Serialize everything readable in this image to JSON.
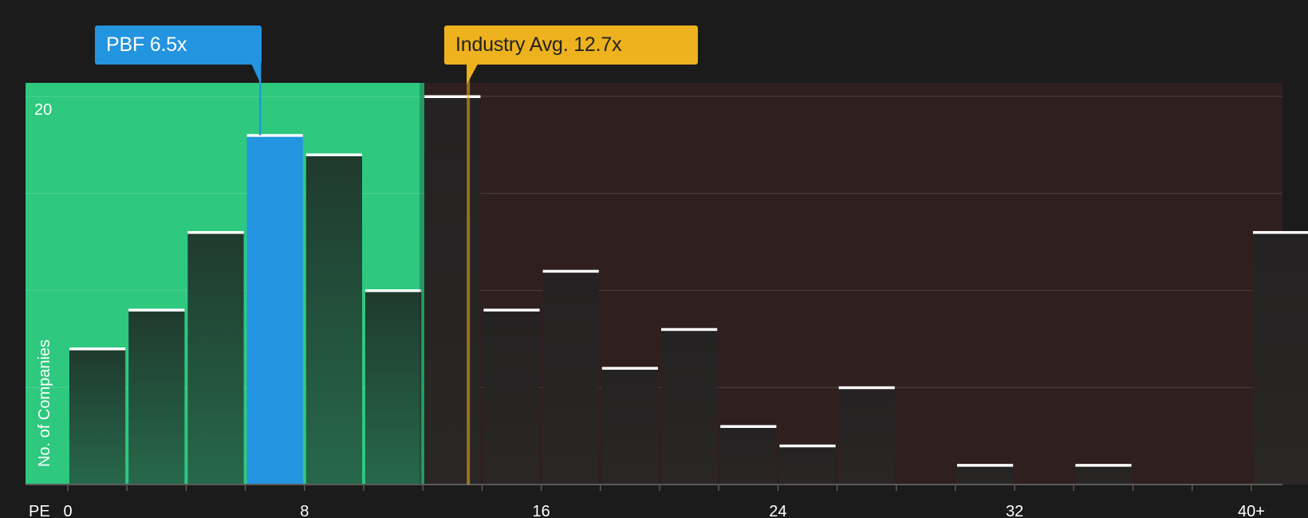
{
  "company_label": "PBF 6.5x",
  "industry_label": "Industry Avg. 12.7x",
  "colors": {
    "background": "#1b1b1b",
    "undervalued_zone": "#2ec87f",
    "overvalued_zone": "#2f1f1f",
    "company_accent": "#2394e0",
    "industry_accent": "#edb21d",
    "bar_cap": "#ffffff"
  },
  "chart_data": {
    "type": "bar",
    "title": "",
    "xlabel": "PE",
    "ylabel": "No. of Companies",
    "x_ticks": [
      "0",
      "8",
      "16",
      "24",
      "32",
      "40+"
    ],
    "y_ticks": [
      "20"
    ],
    "ylim": [
      0,
      20
    ],
    "bin_width": 2,
    "bins": [
      {
        "x_start": 0,
        "count": 7
      },
      {
        "x_start": 2,
        "count": 9
      },
      {
        "x_start": 4,
        "count": 13
      },
      {
        "x_start": 6,
        "count": 18,
        "highlight": true
      },
      {
        "x_start": 8,
        "count": 17
      },
      {
        "x_start": 10,
        "count": 10
      },
      {
        "x_start": 12,
        "count": 20
      },
      {
        "x_start": 14,
        "count": 9
      },
      {
        "x_start": 16,
        "count": 11
      },
      {
        "x_start": 18,
        "count": 6
      },
      {
        "x_start": 20,
        "count": 8
      },
      {
        "x_start": 22,
        "count": 3
      },
      {
        "x_start": 24,
        "count": 2
      },
      {
        "x_start": 26,
        "count": 5
      },
      {
        "x_start": 30,
        "count": 1
      },
      {
        "x_start": 34,
        "count": 1
      },
      {
        "x_start": 40,
        "count": 13
      }
    ],
    "company_pe": 6.5,
    "industry_avg_pe": 12.7,
    "grid": true
  }
}
